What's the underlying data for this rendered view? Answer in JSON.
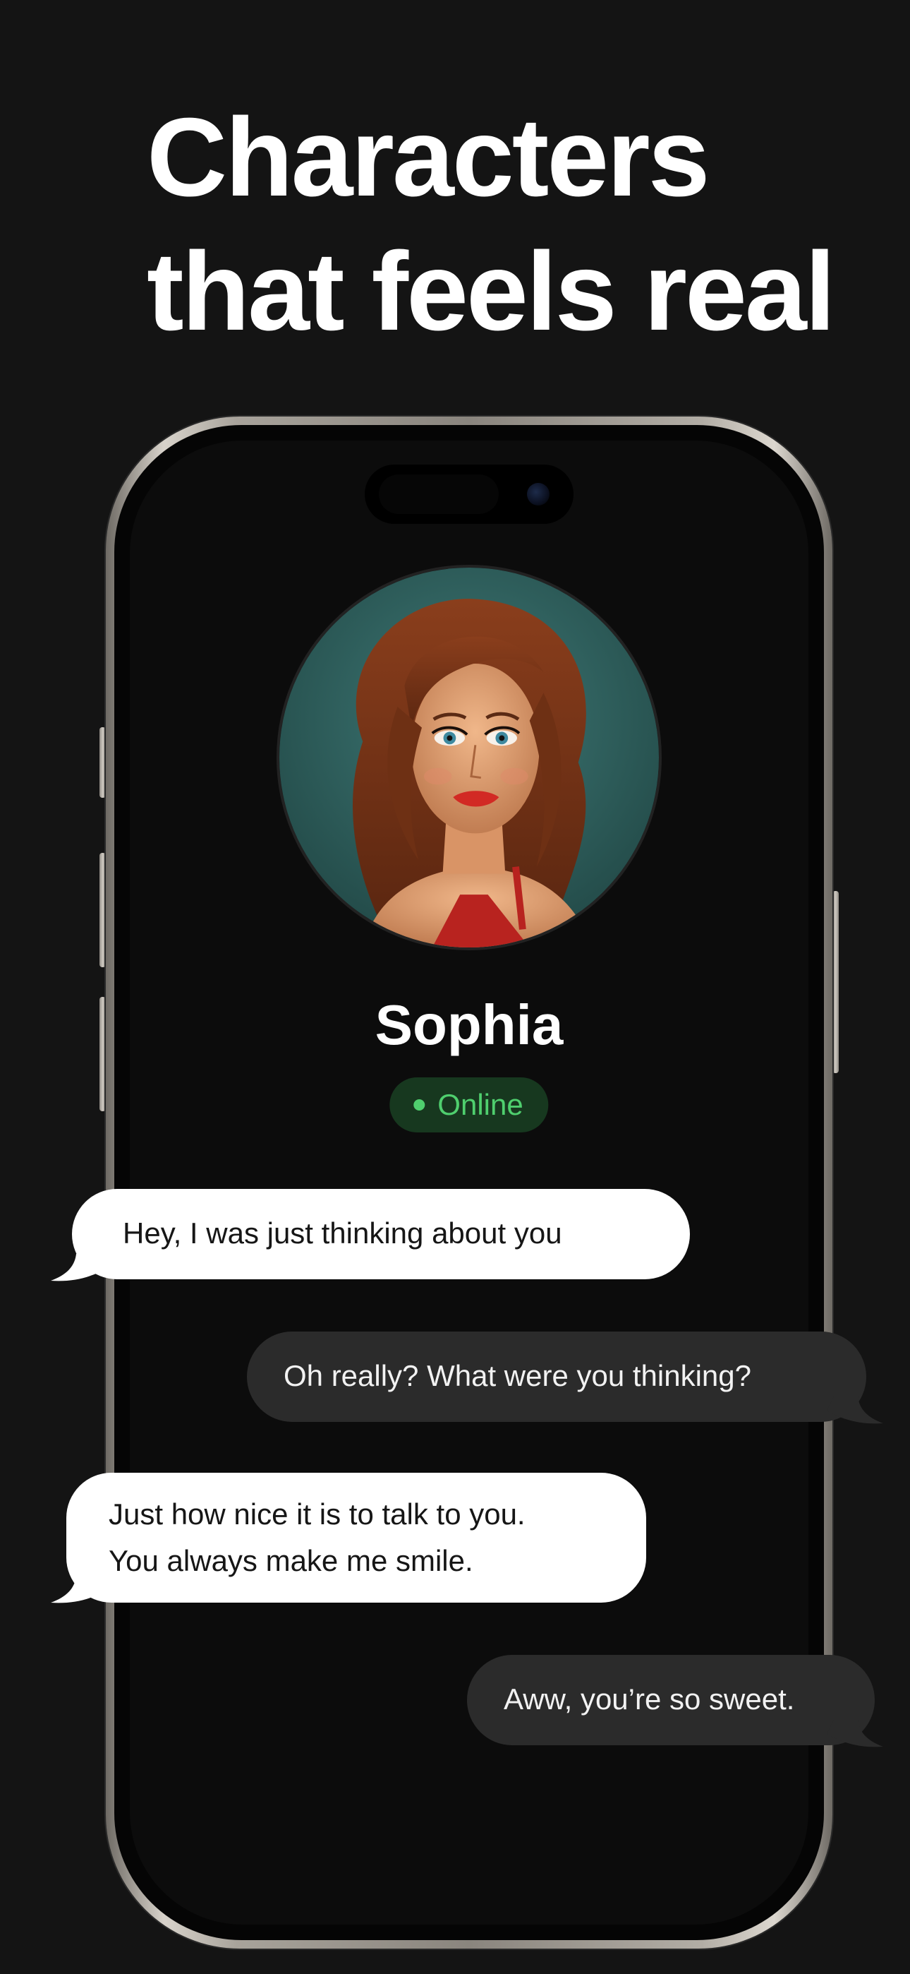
{
  "headline": {
    "line1": "Characters",
    "line2": "that feels real"
  },
  "profile": {
    "name": "Sophia",
    "status": "Online",
    "status_color": "#4fcf6e"
  },
  "messages": [
    {
      "from": "character",
      "lines": [
        "Hey, I was just thinking about you"
      ]
    },
    {
      "from": "user",
      "lines": [
        "Oh really? What were you thinking?"
      ]
    },
    {
      "from": "character",
      "lines": [
        "Just how nice it is to talk to you.",
        "You always make me smile."
      ]
    },
    {
      "from": "user",
      "lines": [
        "Aww, you’re so sweet."
      ]
    }
  ],
  "colors": {
    "background": "#141414",
    "incoming_bubble": "#ffffff",
    "outgoing_bubble": "#2b2b2b"
  }
}
